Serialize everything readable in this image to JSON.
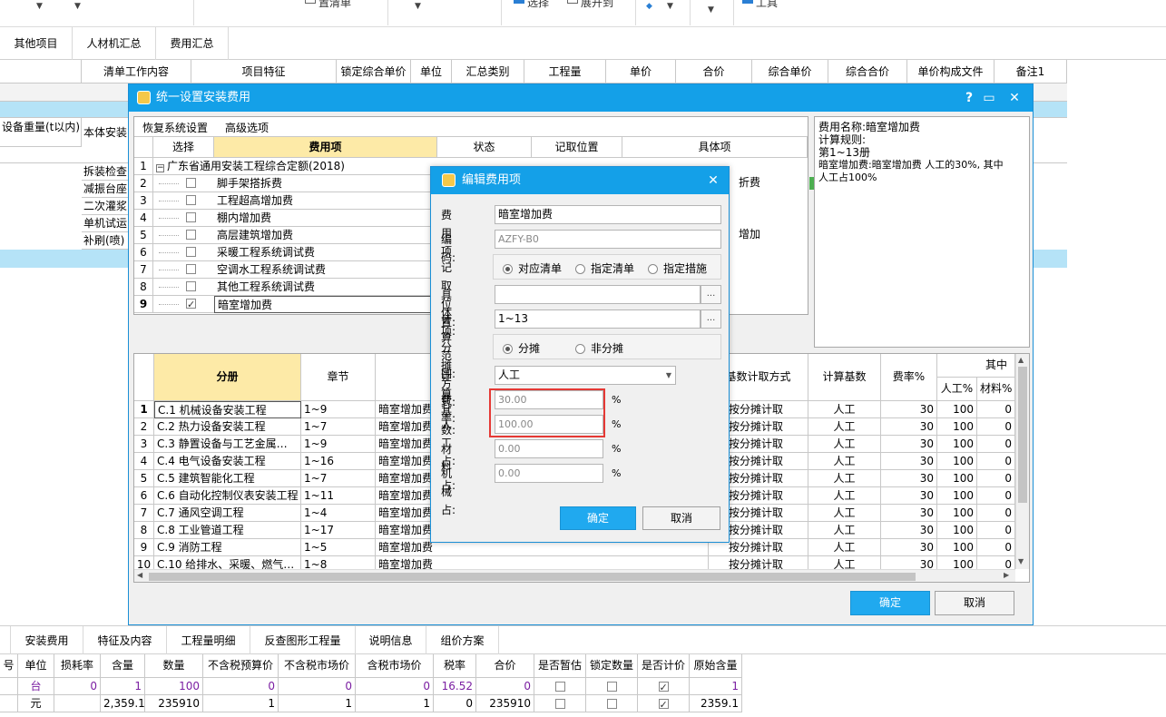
{
  "toolbar": {
    "items": [
      "置清单",
      "选择",
      "展开到",
      "工具"
    ]
  },
  "top_tabs": [
    "其他项目",
    "人材机汇总",
    "费用汇总"
  ],
  "bg_grid": {
    "headers": [
      "清单工作内容",
      "项目特征",
      "锁定综合单价",
      "单位",
      "汇总类别",
      "工程量",
      "单价",
      "合价",
      "综合单价",
      "综合合价",
      "单价构成文件",
      "备注1"
    ],
    "left_rows": [
      "设备重量(t以内)",
      "本体安装"
    ],
    "sub_items": [
      "拆装检查",
      "减振台座",
      "二次灌浆",
      "单机试运",
      "补刷(喷)"
    ]
  },
  "main_dialog": {
    "title": "统一设置安装费用",
    "help": "?",
    "menu": [
      "恢复系统设置",
      "高级选项"
    ],
    "upper_headers": [
      "选择",
      "费用项",
      "状态",
      "记取位置",
      "具体项"
    ],
    "upper_rows": [
      {
        "n": "1",
        "name": "广东省通用安装工程综合定额(2018)",
        "checked": false,
        "group": true
      },
      {
        "n": "2",
        "name": "脚手架搭拆费",
        "checked": false
      },
      {
        "n": "3",
        "name": "工程超高增加费",
        "checked": false
      },
      {
        "n": "4",
        "name": "棚内增加费",
        "checked": false
      },
      {
        "n": "5",
        "name": "高层建筑增加费",
        "checked": false
      },
      {
        "n": "6",
        "name": "采暖工程系统调试费",
        "checked": false
      },
      {
        "n": "7",
        "name": "空调水工程系统调试费",
        "checked": false
      },
      {
        "n": "8",
        "name": "其他工程系统调试费",
        "checked": false
      },
      {
        "n": "9",
        "name": "暗室增加费",
        "checked": true
      }
    ],
    "right_fragments": [
      "折费",
      "增加"
    ],
    "info": [
      "费用名称:暗室增加费",
      "计算规则:",
      "第1~13册",
      "暗室增加费:暗室增加费 人工的30%, 其中",
      "人工占100%"
    ],
    "lower_headers": [
      "分册",
      "章节",
      "基数计取方式",
      "计算基数",
      "费率%",
      "其中",
      "人工%",
      "材料%"
    ],
    "lower_rows": [
      {
        "n": "1",
        "book": "C.1 机械设备安装工程",
        "ch": "1~9",
        "fee": "暗室增加费",
        "mode": "按分摊计取",
        "base": "人工",
        "rate": "30",
        "lab": "100",
        "mat": "0"
      },
      {
        "n": "2",
        "book": "C.2 热力设备安装工程",
        "ch": "1~7",
        "fee": "暗室增加费",
        "mode": "按分摊计取",
        "base": "人工",
        "rate": "30",
        "lab": "100",
        "mat": "0"
      },
      {
        "n": "3",
        "book": "C.3 静置设备与工艺金属…",
        "ch": "1~9",
        "fee": "暗室增加费",
        "mode": "按分摊计取",
        "base": "人工",
        "rate": "30",
        "lab": "100",
        "mat": "0"
      },
      {
        "n": "4",
        "book": "C.4 电气设备安装工程",
        "ch": "1~16",
        "fee": "暗室增加费",
        "mode": "按分摊计取",
        "base": "人工",
        "rate": "30",
        "lab": "100",
        "mat": "0"
      },
      {
        "n": "5",
        "book": "C.5 建筑智能化工程",
        "ch": "1~7",
        "fee": "暗室增加费",
        "mode": "按分摊计取",
        "base": "人工",
        "rate": "30",
        "lab": "100",
        "mat": "0"
      },
      {
        "n": "6",
        "book": "C.6 自动化控制仪表安装工程",
        "ch": "1~11",
        "fee": "暗室增加费",
        "mode": "按分摊计取",
        "base": "人工",
        "rate": "30",
        "lab": "100",
        "mat": "0"
      },
      {
        "n": "7",
        "book": "C.7 通风空调工程",
        "ch": "1~4",
        "fee": "暗室增加费",
        "mode": "按分摊计取",
        "base": "人工",
        "rate": "30",
        "lab": "100",
        "mat": "0"
      },
      {
        "n": "8",
        "book": "C.8 工业管道工程",
        "ch": "1~17",
        "fee": "暗室增加费",
        "mode": "按分摊计取",
        "base": "人工",
        "rate": "30",
        "lab": "100",
        "mat": "0"
      },
      {
        "n": "9",
        "book": "C.9 消防工程",
        "ch": "1~5",
        "fee": "暗室增加费",
        "mode": "按分摊计取",
        "base": "人工",
        "rate": "30",
        "lab": "100",
        "mat": "0"
      },
      {
        "n": "10",
        "book": "C.10 给排水、采暖、燃气…",
        "ch": "1~8",
        "fee": "暗室增加费",
        "mode": "按分摊计取",
        "base": "人工",
        "rate": "30",
        "lab": "100",
        "mat": "0"
      }
    ],
    "ok": "确定",
    "cancel": "取消"
  },
  "edit_dialog": {
    "title": "编辑费用项",
    "fee_item_label": "费用项",
    "fee_item_value": "暗室增加费",
    "code_label": "编码:",
    "code_value": "AZFY-B0",
    "position_label": "记取位置:",
    "position_options": [
      "对应清单",
      "指定清单",
      "指定措施"
    ],
    "position_selected": 0,
    "specific_label": "具体项:",
    "specific_value": "",
    "range_label": "计算范围:",
    "range_value": "1~13",
    "split_label": "分摊方式:",
    "split_options": [
      "分摊",
      "非分摊"
    ],
    "split_selected": 0,
    "base_label": "计算基数:",
    "base_value": "人工",
    "rate_label": "费率:",
    "rate_value": "30.00",
    "labor_label": "人工占:",
    "labor_value": "100.00",
    "material_label": "材料占:",
    "material_value": "0.00",
    "machine_label": "机械占:",
    "machine_value": "0.00",
    "pct": "%",
    "dots": "...",
    "ok": "确定",
    "cancel": "取消",
    "highlight_color": "#e53935"
  },
  "bottom_tabs": [
    "安装费用",
    "特征及内容",
    "工程量明细",
    "反查图形工程量",
    "说明信息",
    "组价方案"
  ],
  "bottom_grid": {
    "headers": [
      "号",
      "单位",
      "损耗率",
      "含量",
      "数量",
      "不含税预算价",
      "不含税市场价",
      "含税市场价",
      "税率",
      "合价",
      "是否暂估",
      "锁定数量",
      "是否计价",
      "原始含量"
    ],
    "rows": [
      {
        "unit": "台",
        "loss": "0",
        "content": "1",
        "qty": "100",
        "p1": "0",
        "p2": "0",
        "p3": "0",
        "tax": "16.52",
        "total": "0",
        "est": false,
        "lock": false,
        "price": true,
        "orig": "1"
      },
      {
        "unit": "元",
        "loss": "",
        "content": "2,359.1",
        "qty": "235910",
        "p1": "1",
        "p2": "1",
        "p3": "1",
        "tax": "0",
        "total": "235910",
        "est": false,
        "lock": false,
        "price": true,
        "orig": "2359.1"
      }
    ]
  },
  "colors": {
    "title_bar": "#14a0e8",
    "primary_button": "#20a9ef",
    "section_header": "#fdeaa7",
    "selected_row": "#b5e3f7"
  }
}
